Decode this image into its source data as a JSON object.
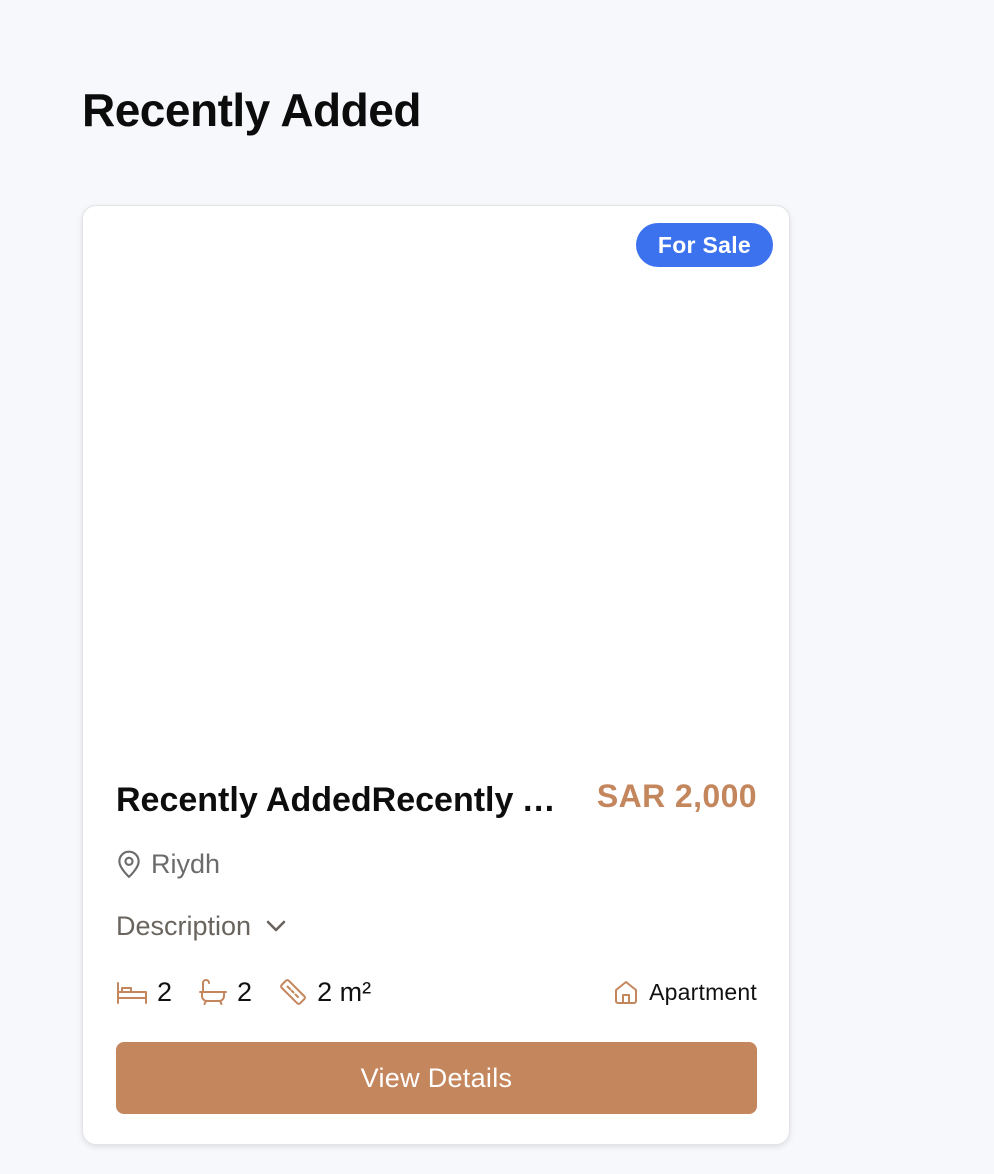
{
  "section": {
    "title": "Recently Added"
  },
  "listing": {
    "badge": "For Sale",
    "title": "Recently AddedRecently Added",
    "price": "SAR 2,000",
    "location": "Riydh",
    "description_toggle": "Description",
    "bedrooms": "2",
    "bathrooms": "2",
    "area": "2 m²",
    "property_type": "Apartment",
    "cta_label": "View Details"
  },
  "icons": {
    "location": "map-pin-icon",
    "description": "chevron-down-icon",
    "bedrooms": "bed-icon",
    "bathrooms": "bathtub-icon",
    "area": "ruler-icon",
    "property_type": "home-icon"
  },
  "colors": {
    "accent": "#c4865d",
    "badge": "#3d72ee",
    "background": "#f7f8fb"
  }
}
